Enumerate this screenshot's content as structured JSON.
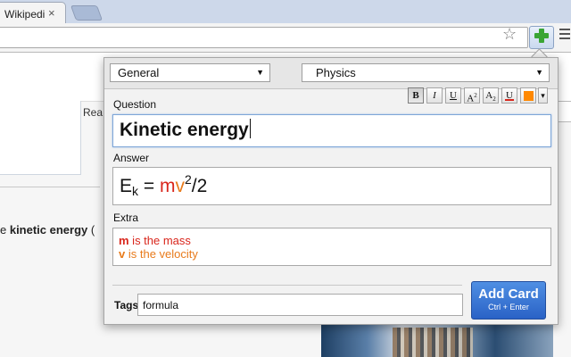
{
  "browser": {
    "tab_title": "Wikipedi",
    "tab_close": "×",
    "star_icon": "star-icon",
    "extension_icon": "green-plus-icon",
    "menu_icon": "hamburger-menu-icon"
  },
  "page": {
    "partial_label": "Rea",
    "text_prefix": "e ",
    "text_bold": "kinetic energy",
    "text_suffix": " ("
  },
  "popup": {
    "deck": "General",
    "model": "Physics",
    "question_label": "Question",
    "question_value": "Kinetic energy",
    "answer_label": "Answer",
    "answer": {
      "base": "E",
      "sub": "k",
      "eq": " = ",
      "m": "m",
      "v": "v",
      "sup": "2",
      "rest": "/2"
    },
    "extra_label": "Extra",
    "extra": {
      "line1_var": "m",
      "line1_text": " is the mass",
      "line2_var": "v",
      "line2_text": " is the velocity"
    },
    "format_buttons": [
      {
        "label": "B",
        "name": "bold"
      },
      {
        "label": "I",
        "name": "italic"
      },
      {
        "label": "U",
        "name": "underline"
      },
      {
        "label": "A",
        "name": "superscript"
      },
      {
        "label": "A",
        "name": "subscript"
      },
      {
        "label": "U",
        "name": "clear-format"
      },
      {
        "label": "",
        "name": "text-color"
      },
      {
        "label": "▾",
        "name": "more-options"
      }
    ],
    "tags_label": "Tags",
    "tags_value": "formula",
    "add_button": "Add Card",
    "add_shortcut": "Ctrl + Enter"
  },
  "colors": {
    "accent_blue": "#2a62c6",
    "red": "#d9261c",
    "orange": "#e87b1c",
    "swatch": "#ff8800"
  }
}
